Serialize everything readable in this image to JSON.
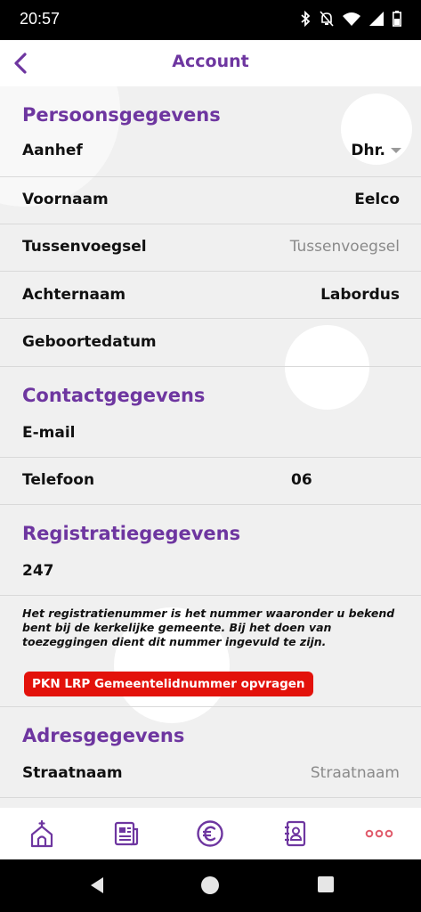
{
  "status_bar": {
    "time": "20:57"
  },
  "header": {
    "title": "Account"
  },
  "sections": {
    "personal": {
      "title": "Persoonsgegevens",
      "salutation_label": "Aanhef",
      "salutation_value": "Dhr.",
      "first_name_label": "Voornaam",
      "first_name_value": "Eelco",
      "infix_label": "Tussenvoegsel",
      "infix_placeholder": "Tussenvoegsel",
      "last_name_label": "Achternaam",
      "last_name_value": "Labordus",
      "birthdate_label": "Geboortedatum"
    },
    "contact": {
      "title": "Contactgegevens",
      "email_label": "E-mail",
      "phone_label": "Telefoon",
      "phone_value": "06"
    },
    "registration": {
      "title": "Registratiegegevens",
      "number": "247",
      "note": "Het registratienummer is het nummer waaronder u bekend bent bij de kerkelijke gemeente. Bij het doen van toezeggingen dient dit nummer ingevuld te zijn.",
      "button_label": "PKN LRP Gemeentelidnummer opvragen"
    },
    "address": {
      "title": "Adresgegevens",
      "street_label": "Straatnaam",
      "street_placeholder": "Straatnaam"
    }
  },
  "bottom_nav": {
    "items": [
      {
        "icon": "church-icon"
      },
      {
        "icon": "news-icon"
      },
      {
        "icon": "euro-icon"
      },
      {
        "icon": "contacts-icon"
      },
      {
        "icon": "more-dots-icon"
      }
    ]
  },
  "colors": {
    "accent": "#6e36a0",
    "button_red": "#e3120b",
    "more_dots": "#e05a6a"
  }
}
